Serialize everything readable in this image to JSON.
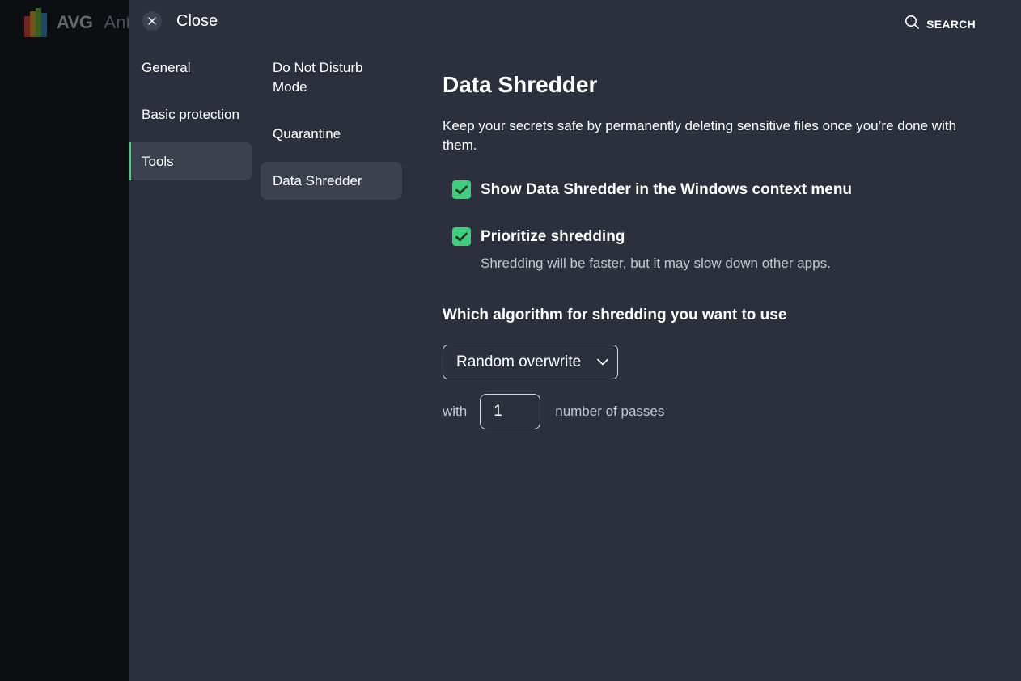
{
  "background_app": {
    "logo_text": "AVG",
    "product_text": "Ant"
  },
  "header": {
    "close_label": "Close",
    "search_label": "SEARCH"
  },
  "nav": {
    "categories": [
      {
        "label": "General"
      },
      {
        "label": "Basic protection"
      },
      {
        "label": "Tools"
      }
    ],
    "subitems": [
      {
        "label": "Do Not Disturb Mode"
      },
      {
        "label": "Quarantine"
      },
      {
        "label": "Data Shredder"
      }
    ]
  },
  "content": {
    "title": "Data Shredder",
    "description": "Keep your secrets safe by permanently deleting sensitive files once you’re done with them.",
    "options": [
      {
        "label": "Show Data Shredder in the Windows context menu",
        "checked": true
      },
      {
        "label": "Prioritize shredding",
        "checked": true,
        "sublabel": "Shredding will be faster, but it may slow down other apps."
      }
    ],
    "algorithm_heading": "Which algorithm for shredding you want to use",
    "algorithm_selected": "Random overwrite",
    "passes_prefix": "with",
    "passes_value": "1",
    "passes_suffix": "number of passes"
  },
  "colors": {
    "accent": "#3ecf7e",
    "panel_bg": "#2c303c",
    "selected_bg": "#3c414e"
  }
}
